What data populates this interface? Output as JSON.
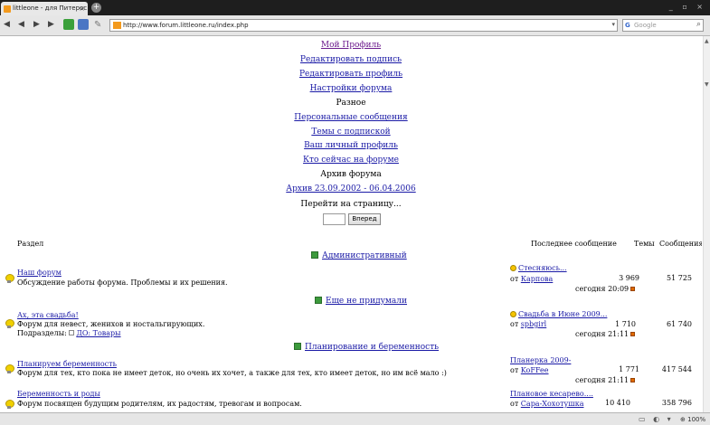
{
  "browser": {
    "tab_title": "littleone - для Питерос…",
    "url": "http://www.forum.littleone.ru/index.php",
    "search_placeholder": "Google",
    "zoom": "100%"
  },
  "menu": {
    "items": [
      {
        "label": "Мой Профиль",
        "style": "visited"
      },
      {
        "label": "Редактировать подпись",
        "style": "link"
      },
      {
        "label": "Редактировать профиль",
        "style": "link"
      },
      {
        "label": "Настройки форума",
        "style": "link"
      },
      {
        "label": "Разное",
        "style": "plain"
      },
      {
        "label": "Персональные сообщения",
        "style": "link"
      },
      {
        "label": "Темы с подпиской",
        "style": "link"
      },
      {
        "label": "Ваш личный профиль",
        "style": "link"
      },
      {
        "label": "Кто сейчас на форуме",
        "style": "link"
      },
      {
        "label": "Архив форума",
        "style": "plain"
      },
      {
        "label": "Архив 23.09.2002 - 06.04.2006",
        "style": "link"
      },
      {
        "label": "Перейти на страницу...",
        "style": "plain"
      }
    ],
    "goto_button": "Вперед"
  },
  "table": {
    "headers": {
      "section": "Раздел",
      "last_post": "Последнее сообщение",
      "topics": "Темы",
      "posts": "Сообщения"
    },
    "categories": [
      {
        "title": "Административный"
      },
      {
        "title": "Еще не придумали"
      },
      {
        "title": "Планирование и беременность"
      }
    ],
    "forums": [
      {
        "title": "Наш форум",
        "desc": "Обсуждение работы форума. Проблемы и их решения.",
        "last_title": "Стесняюсь...",
        "last_by_prefix": "от",
        "last_by": "Карпова",
        "last_time": "сегодня 20:09",
        "topics": "3 969",
        "posts": "51 725"
      },
      {
        "title": "Ах, эта свадьба!",
        "desc": "Форум для невест, женихов и ностальгирующих.",
        "subforums_label": "Подразделы:",
        "subforum": "ДО: Товары",
        "last_title": "Свадьба в Июне 2009...",
        "last_by_prefix": "от",
        "last_by": "spbgirl",
        "last_time": "сегодня 21:11",
        "topics": "1 710",
        "posts": "61 740"
      },
      {
        "title": "Планируем беременность",
        "desc": "Форум для тех, кто пока не имеет деток, но очень их хочет, а также для тех, кто имеет деток, но им всё мало :)",
        "last_title": "Планерка 2009-",
        "last_by_prefix": "от",
        "last_by": "KoFFee",
        "last_time": "сегодня 21:11",
        "topics": "1 771",
        "posts": "417 544"
      },
      {
        "title": "Беременность и роды",
        "desc": "Форум посвящен будущим родителям, их радостям, тревогам и вопросам.",
        "last_title": "Плановое кесарево....",
        "last_by_prefix": "от",
        "last_by": "Сара-Хохотушка",
        "topics": "10 410",
        "posts": "358 796"
      }
    ]
  },
  "colors": {
    "link": "#1a1aa6",
    "visited": "#6b1a8c",
    "category_icon": "#3c9a3c",
    "bulb": "#f0d000"
  }
}
